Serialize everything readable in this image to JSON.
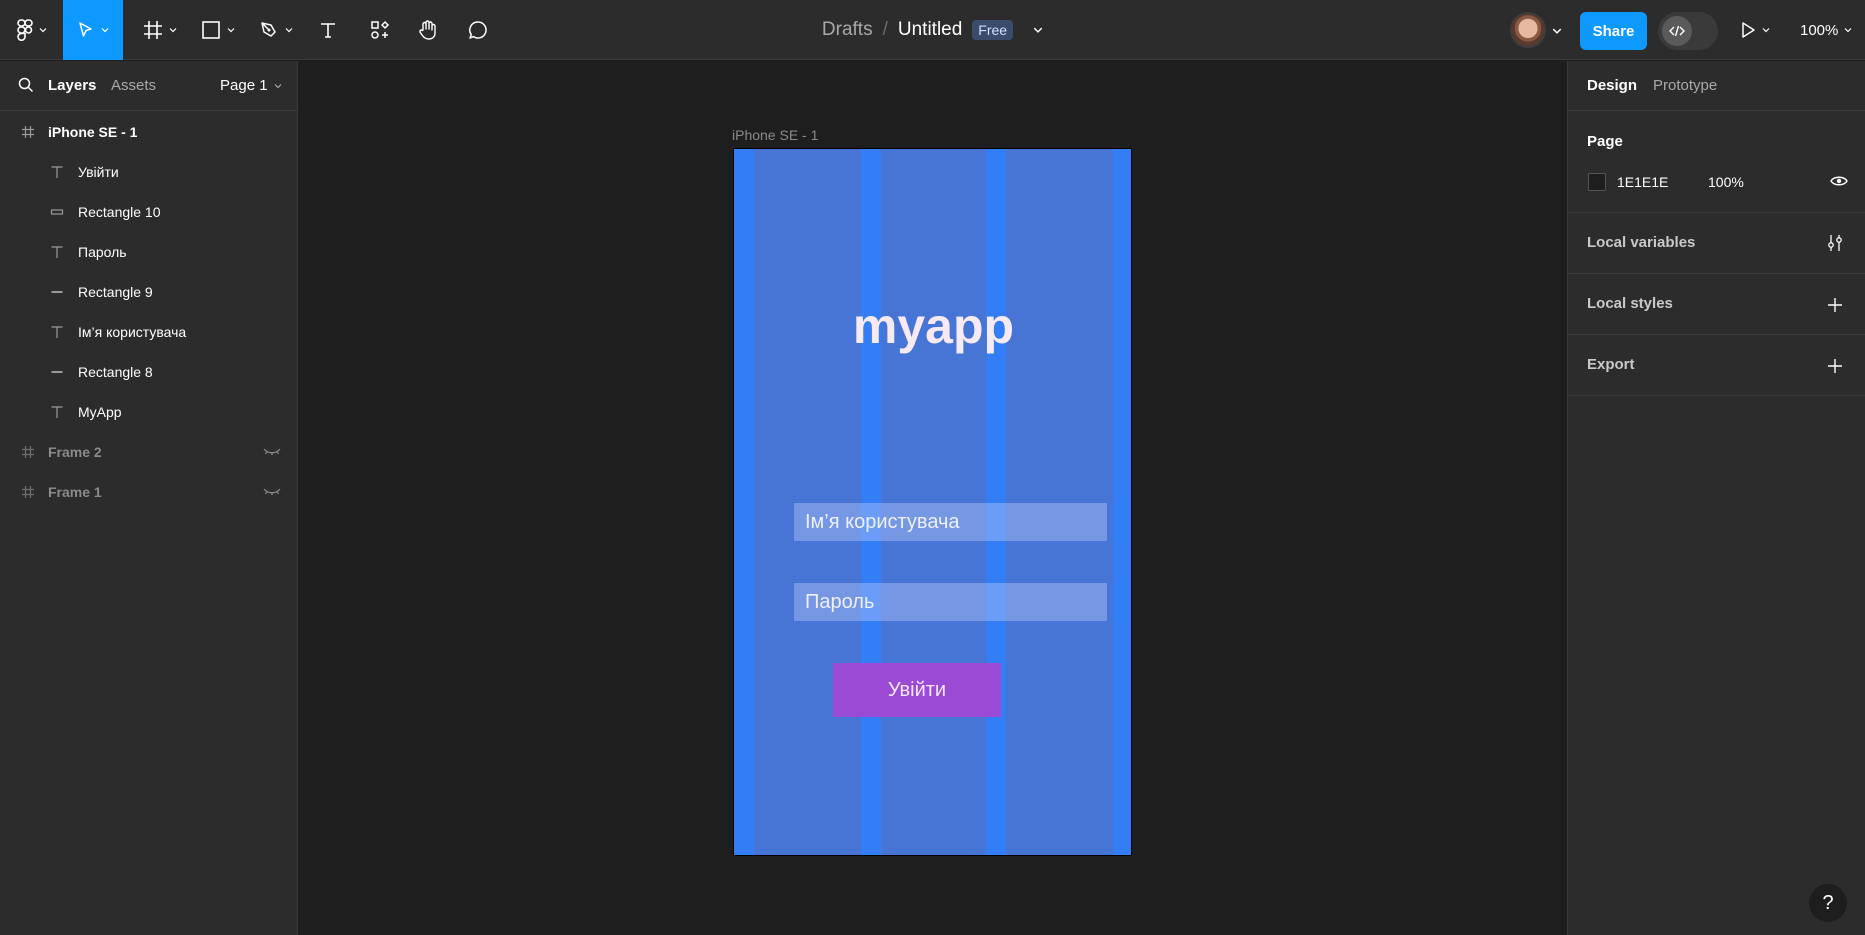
{
  "header": {
    "breadcrumb": "Drafts",
    "separator": "/",
    "title": "Untitled",
    "plan_badge": "Free",
    "share_label": "Share",
    "zoom": "100%"
  },
  "left_panel": {
    "tabs": [
      "Layers",
      "Assets"
    ],
    "page_selector": "Page 1",
    "layers": [
      {
        "label": "iPhone SE - 1",
        "type": "frame",
        "visible": true
      },
      {
        "label": "Увійти",
        "type": "text"
      },
      {
        "label": "Rectangle 10",
        "type": "rect"
      },
      {
        "label": "Пароль",
        "type": "text"
      },
      {
        "label": "Rectangle 9",
        "type": "line"
      },
      {
        "label": "Ім’я користувача",
        "type": "text"
      },
      {
        "label": "Rectangle 8",
        "type": "line"
      },
      {
        "label": "MyApp",
        "type": "text"
      },
      {
        "label": "Frame 2",
        "type": "frame",
        "visible": false
      },
      {
        "label": "Frame 1",
        "type": "frame",
        "visible": false
      }
    ]
  },
  "right_panel": {
    "tabs": [
      "Design",
      "Prototype"
    ],
    "page_section": {
      "title": "Page",
      "color": "1E1E1E",
      "opacity": "100%"
    },
    "sections": [
      "Local variables",
      "Local styles",
      "Export"
    ]
  },
  "canvas": {
    "frame_label": "iPhone SE - 1",
    "app_title": "myapp",
    "username_placeholder": "Ім’я користувача",
    "password_placeholder": "Пароль",
    "login_label": "Увійти"
  },
  "help": "?",
  "colors": {
    "accent": "#0d99ff",
    "panel": "#2c2c2c",
    "canvas": "#1e1e1e",
    "frame_bg": "#4675d6",
    "button": "#9b4ad6"
  }
}
